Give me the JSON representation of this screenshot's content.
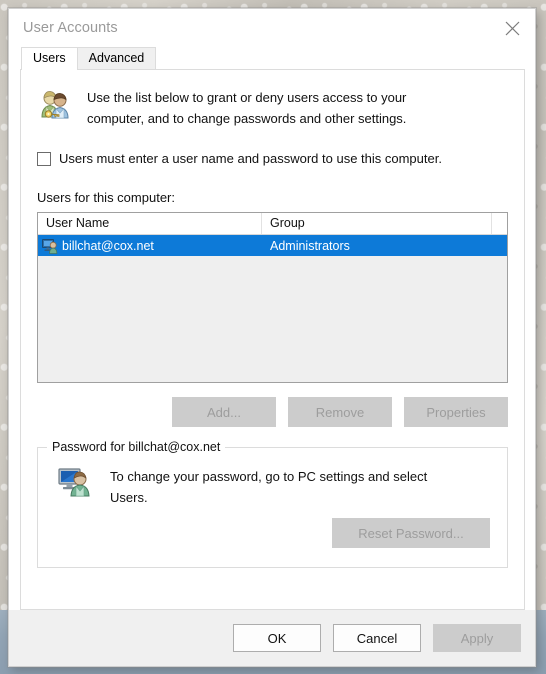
{
  "window": {
    "title": "User Accounts",
    "close_icon": "close-icon"
  },
  "tabs": [
    {
      "label": "Users",
      "active": true
    },
    {
      "label": "Advanced",
      "active": false
    }
  ],
  "users_tab": {
    "header_icon": "users-pair-key-icon",
    "description_line1": "Use the list below to grant or deny users access to your",
    "description_line2": "computer, and to change passwords and other settings.",
    "checkbox": {
      "label": "Users must enter a user name and password to use this computer.",
      "checked": false
    },
    "list_label": "Users for this computer:",
    "list": {
      "columns": [
        "User Name",
        "Group",
        ""
      ],
      "rows": [
        {
          "icon": "user-monitor-icon",
          "user_name": "billchat@cox.net",
          "group": "Administrators",
          "selected": true
        }
      ],
      "selection_color": "#0d7ad8"
    },
    "actions": [
      {
        "label": "Add...",
        "enabled": false
      },
      {
        "label": "Remove",
        "enabled": false
      },
      {
        "label": "Properties",
        "enabled": false
      }
    ],
    "password_group": {
      "legend": "Password for billchat@cox.net",
      "icon": "user-monitor-large-icon",
      "text_line1": "To change your password, go to PC settings and select",
      "text_line2": "Users.",
      "reset_button": {
        "label": "Reset Password...",
        "enabled": false
      }
    }
  },
  "footer": {
    "buttons": [
      {
        "label": "OK",
        "enabled": true
      },
      {
        "label": "Cancel",
        "enabled": true
      },
      {
        "label": "Apply",
        "enabled": false
      }
    ]
  }
}
